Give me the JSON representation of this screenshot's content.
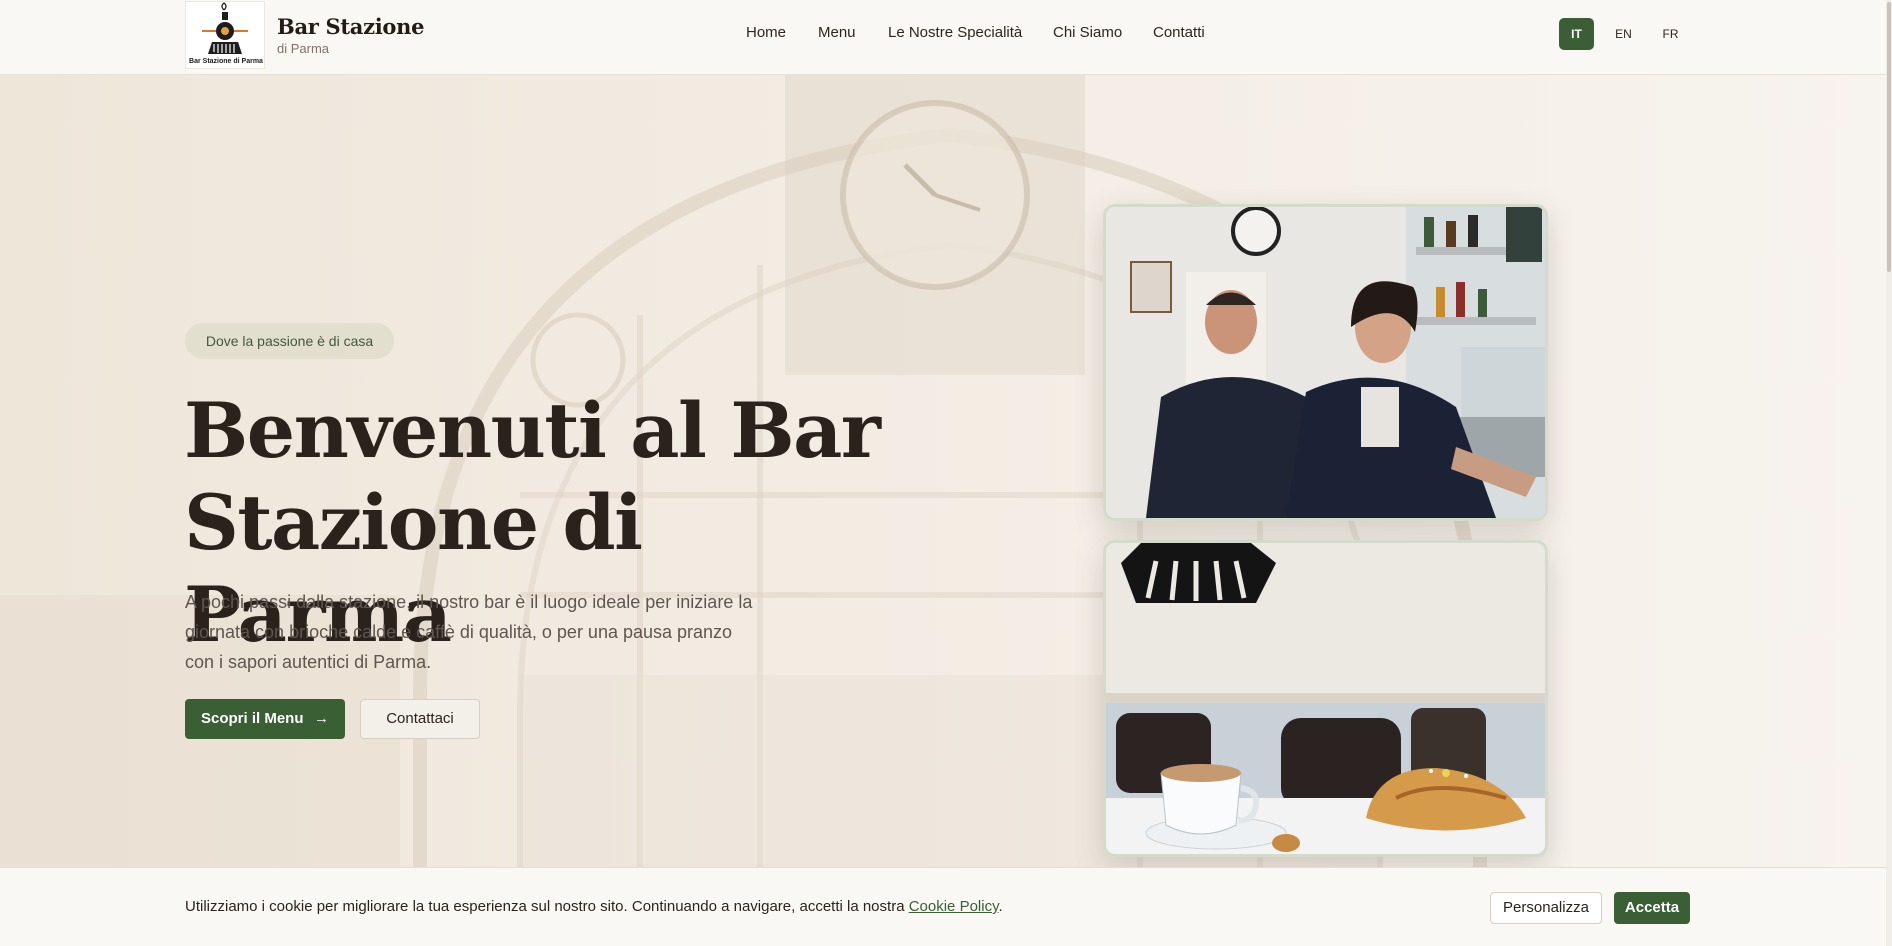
{
  "brand": {
    "logo_caption": "Bar Stazione di Parma",
    "title": "Bar Stazione",
    "subtitle": "di Parma"
  },
  "nav": {
    "items": [
      "Home",
      "Menu",
      "Le Nostre Specialità",
      "Chi Siamo",
      "Contatti"
    ]
  },
  "languages": {
    "items": [
      "IT",
      "EN",
      "FR"
    ],
    "active": "IT"
  },
  "hero": {
    "badge": "Dove la passione è di casa",
    "title_line1": "Benvenuti al Bar",
    "title_line2": "Stazione di Parma",
    "text": "A pochi passi dalla stazione, il nostro bar è il luogo ideale per iniziare la giornata con brioche calde e caffè di qualità, o per una pausa pranzo con i sapori autentici di Parma.",
    "primary_button": "Scopri il Menu",
    "secondary_button": "Contattaci"
  },
  "cookie": {
    "text": "Utilizziamo i cookie per migliorare la tua esperienza sul nostro sito. Continuando a navigare, accetti la nostra",
    "link": "Cookie Policy",
    "suffix": ".",
    "customize_button": "Personalizza",
    "accept_button": "Accetta"
  },
  "colors": {
    "primary_green": "#3a5f35",
    "background": "#f6f1ea",
    "badge_bg": "#e2dfcf",
    "text_dark": "#2a231d"
  }
}
